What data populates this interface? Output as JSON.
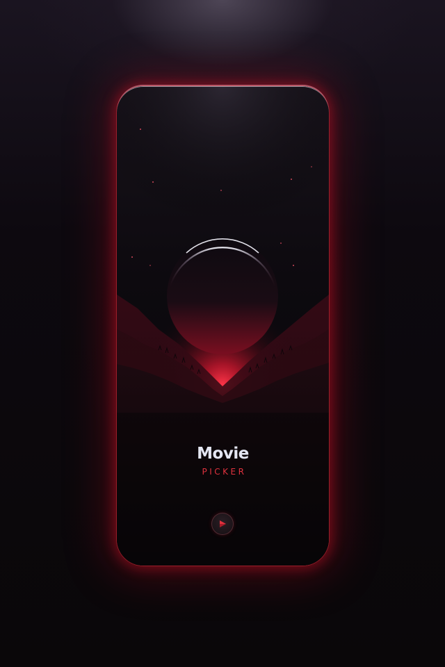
{
  "app": {
    "title": "Movie",
    "subtitle": "PICKER"
  },
  "actions": {
    "start_icon": "play-arrow-icon"
  },
  "colors": {
    "accent": "#e0323e",
    "title_text": "#e4e6f2",
    "background": "#0a070b",
    "glow": "#c8142a"
  }
}
